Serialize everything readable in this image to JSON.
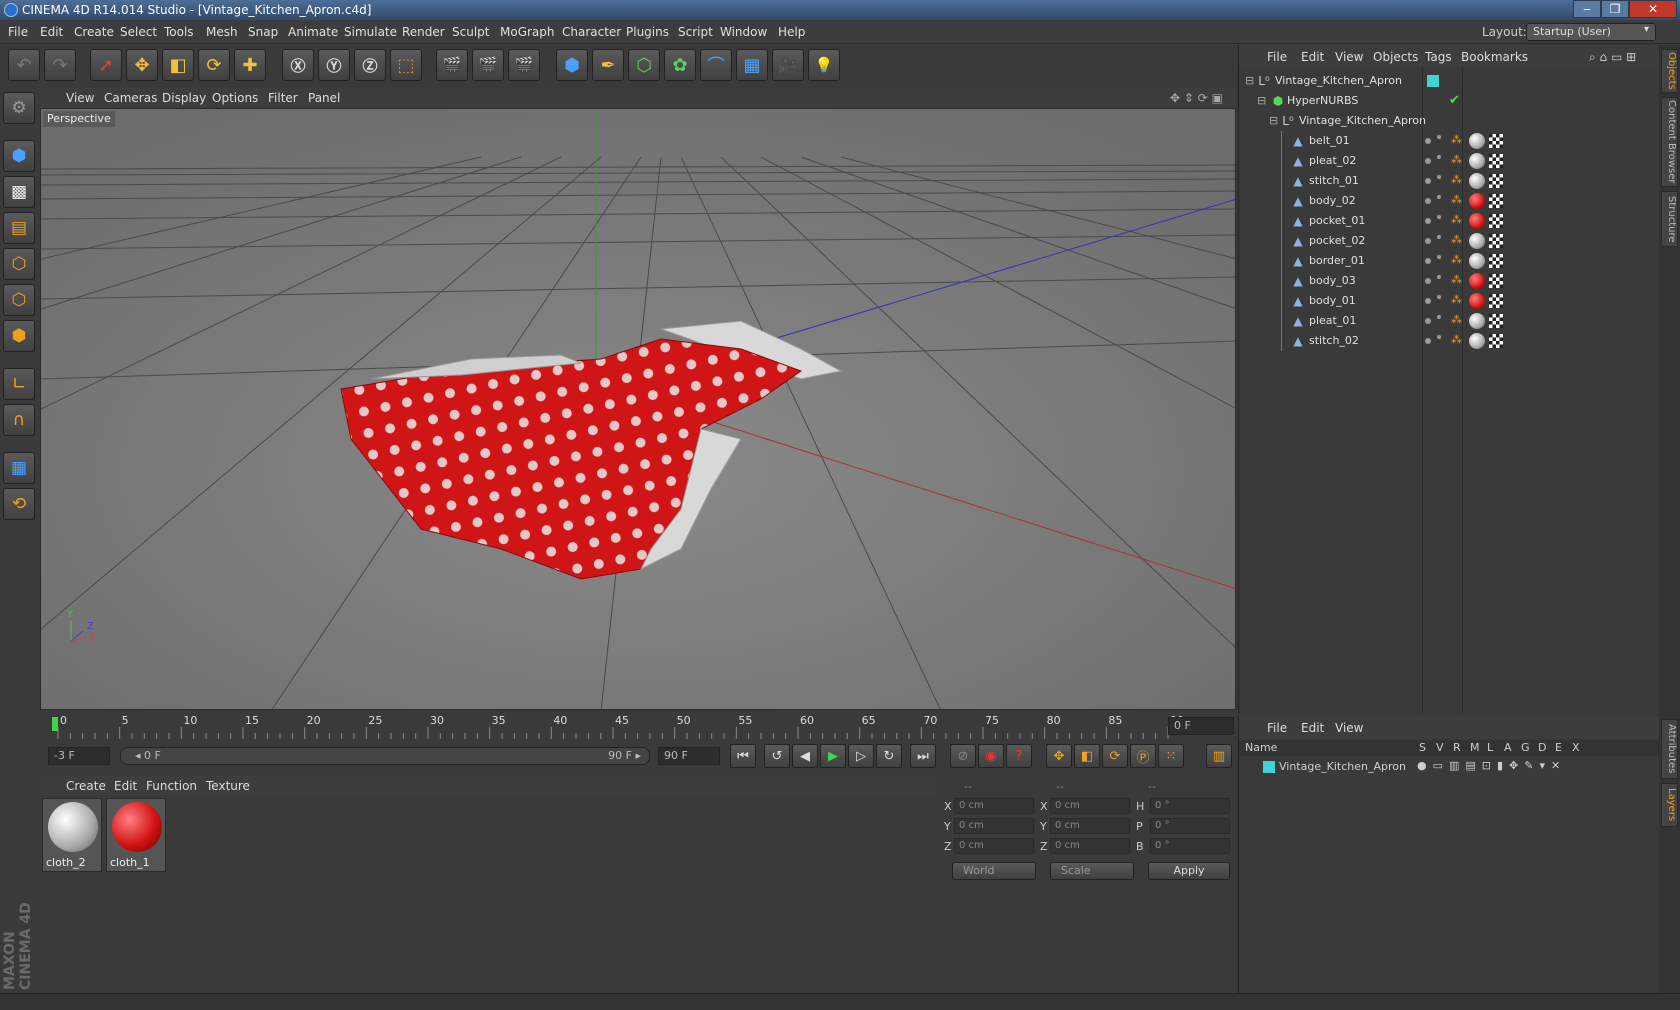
{
  "window": {
    "title": "CINEMA 4D R14.014 Studio - [Vintage_Kitchen_Apron.c4d]",
    "min": "‒",
    "max": "❐",
    "close": "✕"
  },
  "menu": [
    "File",
    "Edit",
    "Create",
    "Select",
    "Tools",
    "Mesh",
    "Snap",
    "Animate",
    "Simulate",
    "Render",
    "Sculpt",
    "MoGraph",
    "Character",
    "Plugins",
    "Script",
    "Window",
    "Help"
  ],
  "layout": {
    "label": "Layout:",
    "value": "Startup (User)"
  },
  "viewport": {
    "menu": [
      "View",
      "Cameras",
      "Display",
      "Options",
      "Filter",
      "Panel"
    ],
    "label": "Perspective",
    "axis_y": "Y",
    "axis_z": "Z",
    "axis_x": "X"
  },
  "timeline": {
    "ticks": [
      "0",
      "5",
      "10",
      "15",
      "20",
      "25",
      "30",
      "35",
      "40",
      "45",
      "50",
      "55",
      "60",
      "65",
      "70",
      "75",
      "80",
      "85",
      "90"
    ],
    "current": "0 F",
    "start": "-3 F",
    "range_start": "◂ 0 F",
    "range_end": "90 F ▸",
    "end": "90 F"
  },
  "materials": {
    "menu": [
      "Create",
      "Edit",
      "Function",
      "Texture"
    ],
    "items": [
      {
        "name": "cloth_2"
      },
      {
        "name": "cloth_1"
      }
    ]
  },
  "coords": {
    "headers": [
      "--",
      "--",
      "--"
    ],
    "rows": [
      {
        "a": "X",
        "av": "0 cm",
        "b": "X",
        "bv": "0 cm",
        "c": "H",
        "cv": "0 °"
      },
      {
        "a": "Y",
        "av": "0 cm",
        "b": "Y",
        "bv": "0 cm",
        "c": "P",
        "cv": "0 °"
      },
      {
        "a": "Z",
        "av": "0 cm",
        "b": "Z",
        "bv": "0 cm",
        "c": "B",
        "cv": "0 °"
      }
    ],
    "world": "World",
    "scale": "Scale",
    "apply": "Apply"
  },
  "objects": {
    "menu": [
      "File",
      "Edit",
      "View",
      "Objects",
      "Tags",
      "Bookmarks"
    ],
    "root": "Vintage_Kitchen_Apron",
    "hypernurbs": "HyperNURBS",
    "group": "Vintage_Kitchen_Apron",
    "items": [
      {
        "name": "belt_01",
        "red": false
      },
      {
        "name": "pleat_02",
        "red": false
      },
      {
        "name": "stitch_01",
        "red": false
      },
      {
        "name": "body_02",
        "red": true
      },
      {
        "name": "pocket_01",
        "red": true
      },
      {
        "name": "pocket_02",
        "red": false
      },
      {
        "name": "border_01",
        "red": false
      },
      {
        "name": "body_03",
        "red": true
      },
      {
        "name": "body_01",
        "red": true
      },
      {
        "name": "pleat_01",
        "red": false
      },
      {
        "name": "stitch_02",
        "red": false
      }
    ]
  },
  "layers": {
    "menu": [
      "File",
      "Edit",
      "View"
    ],
    "cols": [
      "Name",
      "S",
      "V",
      "R",
      "M",
      "L",
      "A",
      "G",
      "D",
      "E",
      "X"
    ],
    "row": "Vintage_Kitchen_Apron"
  },
  "sidetabs": [
    "Objects",
    "Content Browser",
    "Structure",
    "Attributes",
    "Layers"
  ],
  "brand": "MAXON CINEMA 4D",
  "colors": {
    "accent": "#f0a020",
    "cloth": "#d41414",
    "layer": "#3fd3d3"
  }
}
